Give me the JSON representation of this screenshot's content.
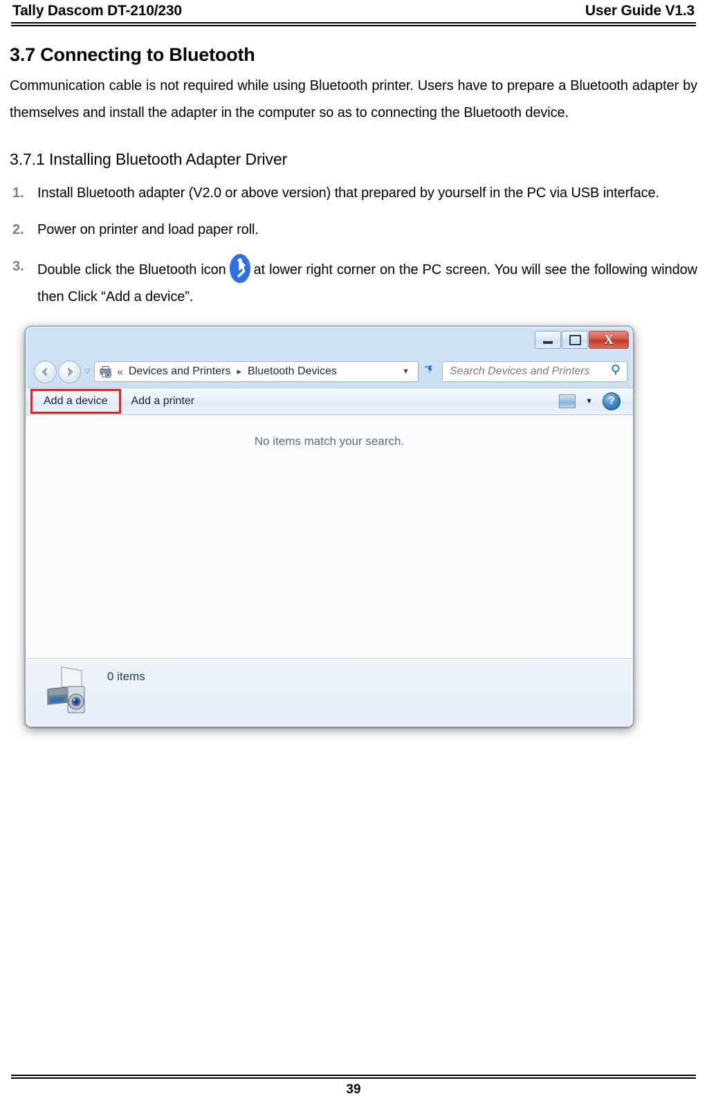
{
  "header": {
    "left": "Tally Dascom DT-210/230",
    "right": "User Guide V1.3"
  },
  "section": {
    "title": "3.7 Connecting to Bluetooth",
    "intro": "Communication cable is not required while using Bluetooth printer. Users have to prepare a Bluetooth adapter by themselves and install the adapter in the computer so as to connecting the Bluetooth device.",
    "subsection_title": "3.7.1 Installing Bluetooth Adapter Driver"
  },
  "steps": [
    {
      "marker": "1.",
      "text": "Install Bluetooth adapter (V2.0 or above version) that prepared by yourself in the PC via USB interface."
    },
    {
      "marker": "2.",
      "text": "Power on printer and load paper roll."
    },
    {
      "marker": "3.",
      "text_before_icon": "Double click the Bluetooth icon",
      "icon": "bluetooth-icon",
      "text_after_icon": "at lower right corner on the PC screen. You will see the following window then Click “Add a device”."
    }
  ],
  "window": {
    "title_bar": {
      "minimize_label": "Minimize",
      "maximize_label": "Maximize",
      "close_label": "X"
    },
    "nav": {
      "back_icon": "back-arrow-icon",
      "forward_icon": "forward-arrow-icon",
      "history_caret": "▽",
      "address_icon": "devices-and-printers-icon",
      "crumb_overflow": "«",
      "crumb_1": "Devices and Printers",
      "crumb_separator": "▸",
      "crumb_2": "Bluetooth Devices",
      "dropdown_caret": "▼",
      "refresh_icon": "refresh-icon"
    },
    "search": {
      "placeholder": "Search Devices and Printers",
      "icon": "search-icon"
    },
    "toolbar": {
      "add_device": "Add a device",
      "add_printer": "Add a printer",
      "view_icon": "view-options-icon",
      "view_caret": "▼",
      "help_label": "?"
    },
    "content": {
      "empty_message": "No items match your search."
    },
    "status": {
      "icon": "printer-scanner-icon",
      "items_count": "0 items"
    }
  },
  "footer": {
    "page_number": "39"
  },
  "colors": {
    "accent_red": "#ee1c1c",
    "bluetooth_blue": "#2d6fe8",
    "marker_grey": "#7f7f7f",
    "aero_blue": "#cfe2f4"
  }
}
